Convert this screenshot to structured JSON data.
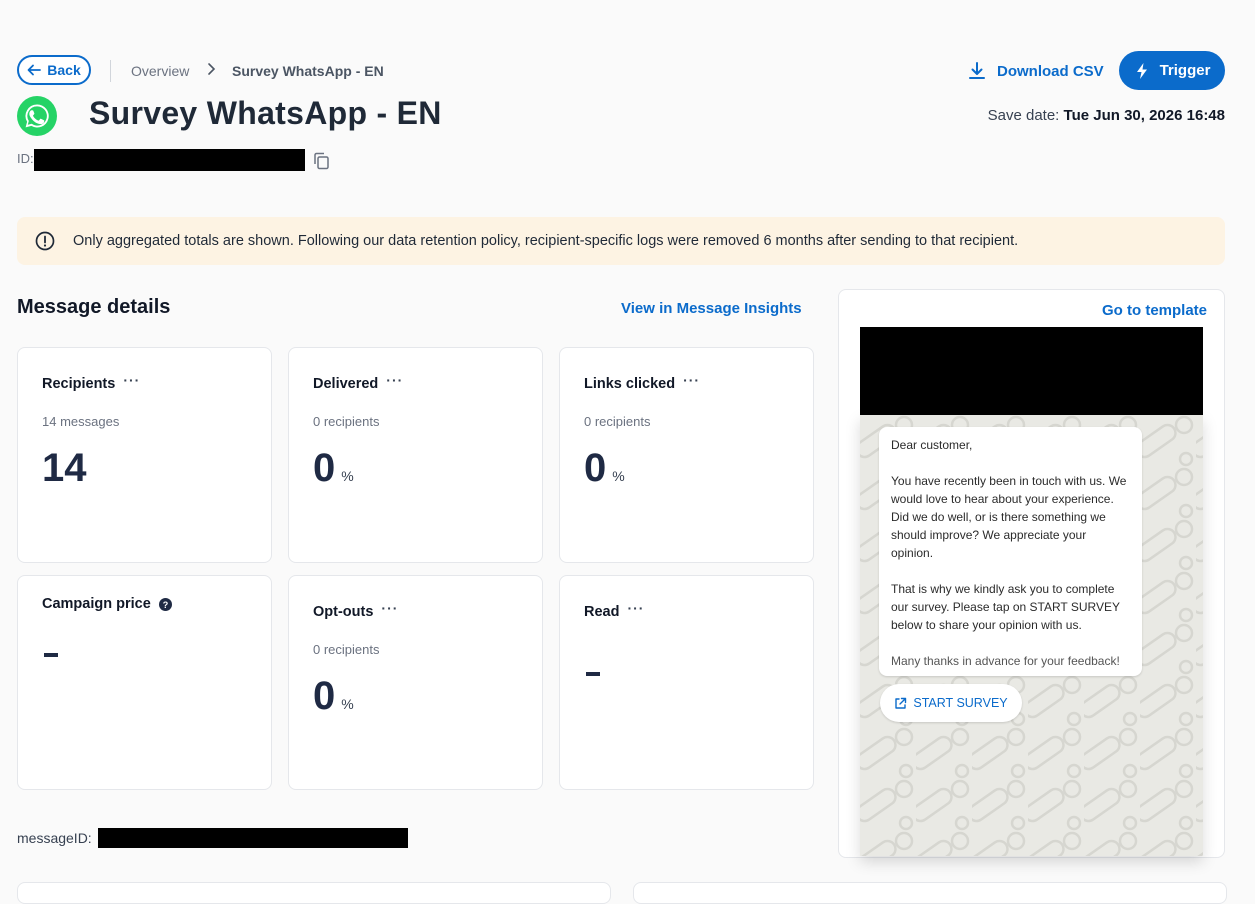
{
  "header": {
    "back_label": "Back",
    "breadcrumb": [
      "Overview",
      "Survey WhatsApp - EN"
    ],
    "download_label": "Download CSV",
    "trigger_label": "Trigger",
    "title": "Survey WhatsApp - EN",
    "save_date_label": "Save date:",
    "save_date_value": "Tue Jun 30, 2026 16:48",
    "id_label": "ID:"
  },
  "banner": {
    "text": "Only aggregated totals are shown. Following our data retention policy, recipient-specific logs were removed 6 months after sending to that recipient."
  },
  "details": {
    "title": "Message details",
    "insights_link": "View in Message Insights",
    "cards": [
      {
        "title": "Recipients",
        "menu": "···",
        "sub": "14 messages",
        "value": "14",
        "unit": ""
      },
      {
        "title": "Delivered",
        "menu": "···",
        "sub": "0 recipients",
        "value": "0",
        "unit": "%"
      },
      {
        "title": "Links clicked",
        "menu": "···",
        "sub": "0 recipients",
        "value": "0",
        "unit": "%"
      },
      {
        "title": "Campaign price",
        "menu": "",
        "sub": "",
        "value": "-",
        "unit": ""
      },
      {
        "title": "Opt-outs",
        "menu": "···",
        "sub": "0 recipients",
        "value": "0",
        "unit": "%"
      },
      {
        "title": "Read",
        "menu": "···",
        "sub": "",
        "value": "-",
        "unit": ""
      }
    ],
    "message_id_label": "messageID:"
  },
  "preview": {
    "goto_link": "Go to template",
    "lines": [
      "Dear customer,",
      "You have recently been in touch with us. We would love to hear about your experience. Did we do well, or is there something we should improve? We appreciate your opinion.",
      "That is why we kindly ask you to complete our survey. Please tap on START SURVEY below to share your opinion with us.",
      "Many thanks in advance for your feedback!"
    ],
    "button_label": "START SURVEY"
  },
  "colors": {
    "accent": "#0b6bcb",
    "banner_bg": "#fdf3e3",
    "whatsapp_green": "#25d366"
  }
}
